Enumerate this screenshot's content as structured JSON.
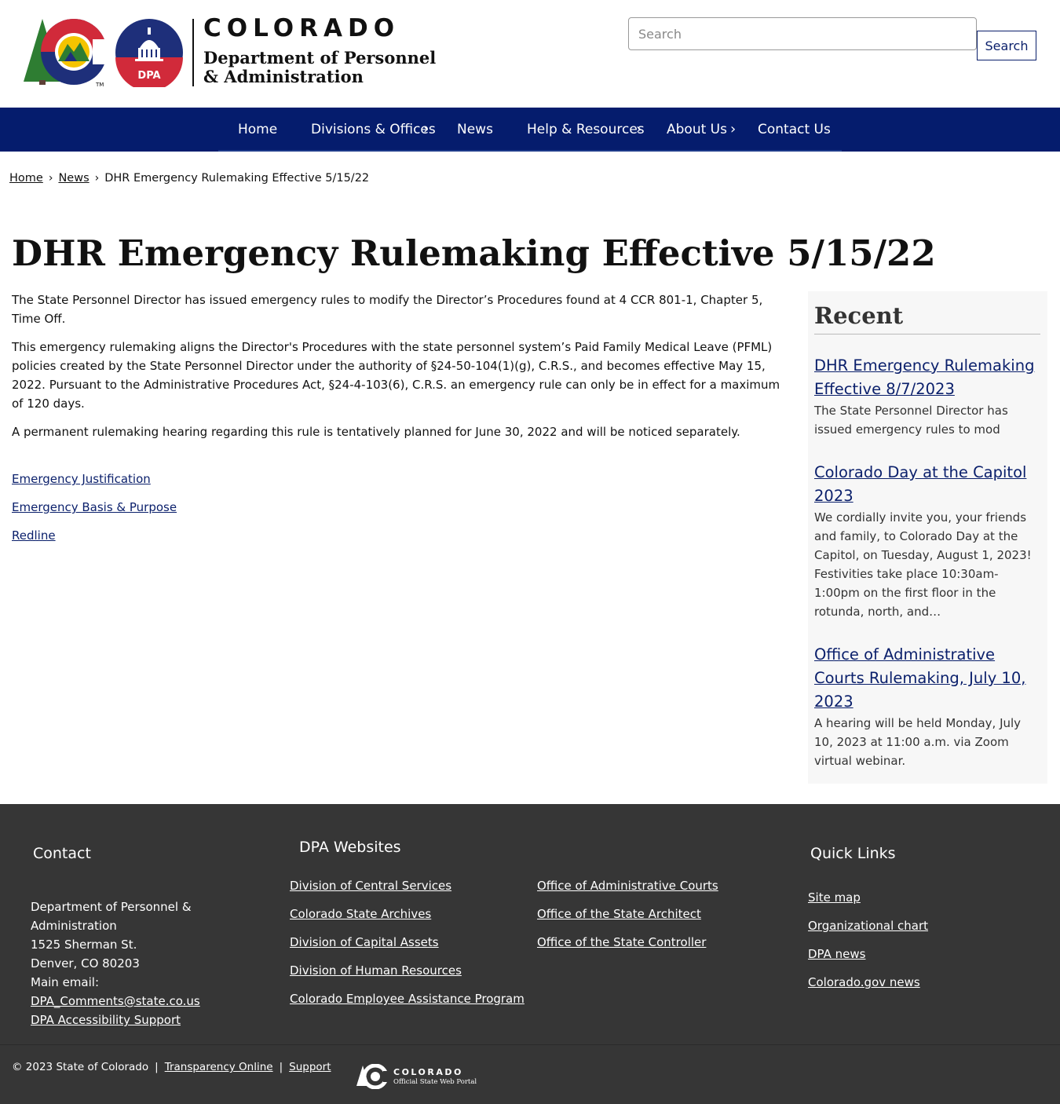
{
  "header": {
    "logo_text_state": "COLORADO",
    "logo_text_dept_line1": "Department of Personnel",
    "logo_text_dept_line2": "& Administration",
    "logo_badge_text": "DPA",
    "search_placeholder": "Search",
    "search_button_label": "Search"
  },
  "nav": {
    "items": [
      {
        "label": "Home",
        "has_submenu": false
      },
      {
        "label": "Divisions & Offices",
        "has_submenu": true
      },
      {
        "label": "News",
        "has_submenu": false
      },
      {
        "label": "Help & Resources",
        "has_submenu": true
      },
      {
        "label": "About Us",
        "has_submenu": true
      },
      {
        "label": "Contact Us",
        "has_submenu": false
      }
    ],
    "chevron": "›"
  },
  "breadcrumb": {
    "items": [
      "Home",
      "News"
    ],
    "current": "DHR Emergency Rulemaking Effective 5/15/22",
    "separator": "›"
  },
  "page": {
    "title": "DHR Emergency Rulemaking Effective 5/15/22",
    "paragraphs": [
      "The State Personnel Director has issued emergency rules to modify the Director’s Procedures found at 4 CCR 801-1, Chapter 5, Time Off.",
      "This emergency rulemaking aligns the Director's Procedures with the state personnel system’s Paid Family Medical Leave (PFML) policies created by the State Personnel Director under the authority of §24-50-104(1)(g), C.R.S., and becomes effective May 15, 2022.  Pursuant to the Administrative Procedures Act, §24-4-103(6), C.R.S. an emergency rule can only be in effect for a maximum of 120 days.",
      "A permanent rulemaking hearing regarding this rule is tentatively planned for June 30, 2022 and will be noticed separately."
    ],
    "documents": [
      "Emergency Justification",
      "Emergency Basis & Purpose",
      "Redline"
    ]
  },
  "sidebar": {
    "title": "Recent",
    "items": [
      {
        "title": "DHR Emergency Rulemaking Effective 8/7/2023",
        "summary": "The State Personnel Director has issued emergency rules to mod"
      },
      {
        "title": "Colorado Day at the Capitol 2023",
        "summary": "We cordially invite you, your friends and family, to Colorado Day at the Capitol, on Tuesday, August 1, 2023!  Festivities take place 10:30am-1:00pm on the first floor in the rotunda, north, and…"
      },
      {
        "title": "Office of Administrative Courts Rulemaking, July 10, 2023",
        "summary": "A hearing will be held Monday, July 10, 2023 at 11:00 a.m. via Zoom virtual webinar."
      }
    ]
  },
  "footer": {
    "contact": {
      "heading": "Contact",
      "lines": [
        "Department of Personnel &",
        "Administration",
        "1525 Sherman St.",
        "Denver, CO 80203",
        "Main email:"
      ],
      "email": "DPA_Comments@state.co.us",
      "accessibility": "DPA Accessibility Support"
    },
    "websites": {
      "heading": "DPA Websites",
      "col1": [
        "Division of Central Services",
        "Colorado State Archives",
        "Division of Capital Assets",
        "Division of Human Resources",
        "Colorado Employee Assistance Program"
      ],
      "col2": [
        "Office of Administrative Courts",
        "Office of the State Architect",
        "Office of the State Controller"
      ]
    },
    "quick_links": {
      "heading": "Quick Links",
      "items": [
        "Site map",
        "Organizational chart",
        "DPA news",
        "Colorado.gov news"
      ]
    },
    "bottom": {
      "copyright": "© 2023 State of Colorado",
      "links": [
        "Transparency Online",
        "Support"
      ],
      "portal_state": "COLORADO",
      "portal_sub": "Official State Web Portal"
    }
  },
  "colors": {
    "nav_bg": "#051c6d",
    "link": "#0a1f6b",
    "footer_bg": "#363636",
    "sidebar_bg": "#f7f7f7",
    "logo_red": "#d12a3a",
    "logo_blue": "#1e2f7a",
    "logo_green": "#2e7d32",
    "logo_gold": "#f5c400"
  }
}
